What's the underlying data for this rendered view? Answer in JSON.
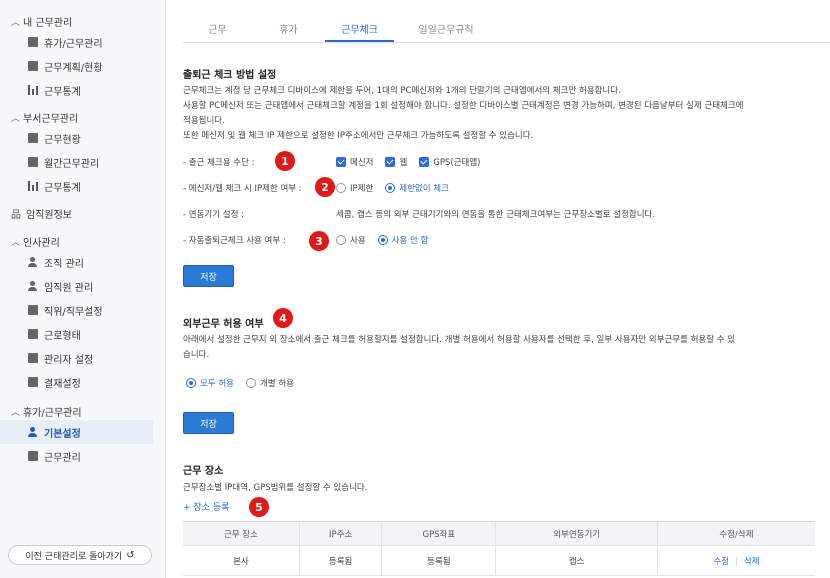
{
  "sidebar": {
    "sections": [
      {
        "title": "내 근무관리",
        "items": [
          "휴가/근무관리",
          "근무계획/현황",
          "근무통계"
        ]
      },
      {
        "title": "부서근무관리",
        "items": [
          "근무현황",
          "월간근무관리",
          "근무통계"
        ]
      },
      {
        "title": "임직원정보"
      },
      {
        "title": "인사관리",
        "items": [
          "조직 관리",
          "임직원 관리",
          "직위/직무설정",
          "근로형태",
          "관리자 설정",
          "결재설정"
        ]
      },
      {
        "title": "휴가/근무관리",
        "items": [
          "기본설정",
          "근무관리"
        ]
      }
    ],
    "back_button": "이전 근태관리로 돌아가기"
  },
  "tabs": [
    "근무",
    "휴가",
    "근무체크",
    "일일근무규칙"
  ],
  "section1": {
    "title": "출퇴근 체크 방법 설정",
    "desc": [
      "근무체크는 계정 당 근무체크 디바이스에 제한을 두어, 1대의 PC메신저와 1개의 단말기의 근태앱에서의 체크만 허용합니다.",
      "사용할 PC메신저 또는 근태앱에서 근태체크할 계정을 1회 설정해야 합니다. 설정한 디바이스별 근태계정은 변경 가능하며, 변경된 다음날부터 실제 근태체크에",
      "적용됩니다.",
      "또한 메신저 및 웹 체크 IP 제한으로 설정한 IP주소에서만 근무체크 가능하도록 설정할 수 있습니다."
    ],
    "rows": {
      "method_label": "- 출근 체크용 수단 :",
      "method_opts": [
        "메신저",
        "웹",
        "GPS(근태앱)"
      ],
      "ip_label": "- 메신저/웹 체크 시 IP제한 여부 :",
      "ip_opts": [
        "IP제한",
        "제한없이 체크"
      ],
      "link_label": "- 연동기기 설정 :",
      "link_value": "세콤, 캡스 등의 외부 근태기기와의 연동을 통한 근태체크여부는 근무장소별로 설정합니다.",
      "auto_label": "- 자동출퇴근체크 사용 여부 :",
      "auto_opts": [
        "사용",
        "사용 안 함"
      ]
    },
    "save": "저장"
  },
  "section2": {
    "title": "외부근무 허용 여부",
    "desc": [
      "아래에서 설정한 근무지 외 장소에서 출근 체크를 허용할지를 설정합니다. 개별 허용에서 허용할 사용자를 선택한 후, 일부 사용자만 외부근무를 허용할 수 있",
      "습니다."
    ],
    "opts": [
      "모두 허용",
      "개별 허용"
    ],
    "save": "저장"
  },
  "section3": {
    "title": "근무 장소",
    "desc": "근무장소별 IP대역, GPS범위를 설정할 수 있습니다.",
    "add": "+ 장소 등록",
    "headers": [
      "근무 장소",
      "IP주소",
      "GPS좌표",
      "외부연동기기",
      "수정/삭제"
    ],
    "row": [
      "본사",
      "등록됨",
      "등록됨",
      "캡스"
    ],
    "edit": "수정",
    "del": "삭제"
  },
  "badges": [
    "1",
    "2",
    "3",
    "4",
    "5"
  ]
}
